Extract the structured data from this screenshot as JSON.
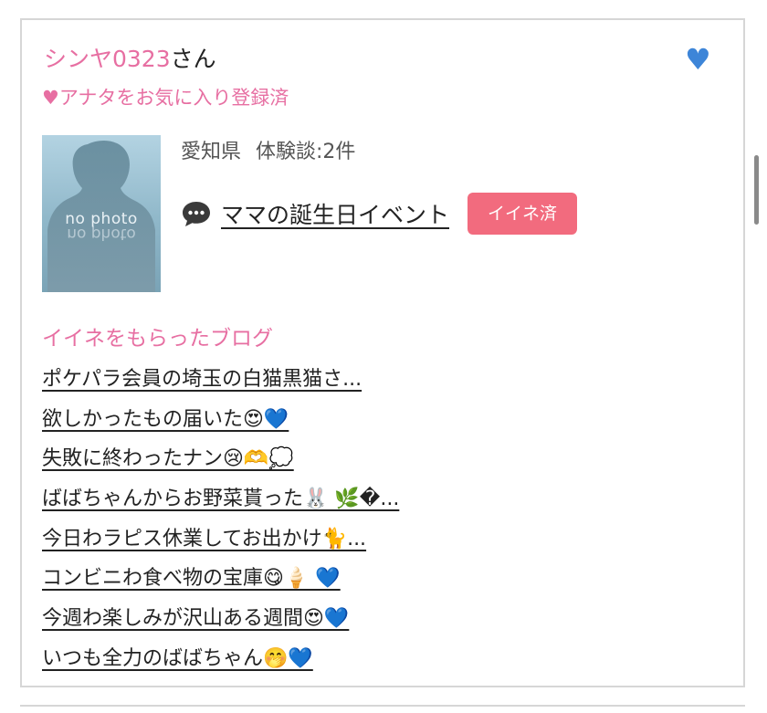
{
  "profile": {
    "user_name": "シンヤ0323",
    "name_suffix": "さん",
    "favorite_status": "♥アナタをお気に入り登録済",
    "favorite_icon": "heart-icon",
    "avatar_placeholder": "no photo",
    "location": "愛知県",
    "review_count": "体験談:2件",
    "event_title": "ママの誕生日イベント",
    "event_icon": "speech-bubble-icon",
    "like_badge": "イイネ済"
  },
  "liked_blogs": {
    "heading": "イイネをもらったブログ",
    "items": [
      {
        "title": "ポケパラ会員の埼玉の白猫黒猫さ..."
      },
      {
        "title": "欲しかったもの届いた😍💙"
      },
      {
        "title": "失敗に終わったナン😢🫶💭"
      },
      {
        "title": "ばばちゃんからお野菜貰った🐰 🌿�..."
      },
      {
        "title": "今日わラピス休業してお出かけ🐈..."
      },
      {
        "title": "コンビニわ食べ物の宝庫😋🍦 💙"
      },
      {
        "title": "今週わ楽しみが沢山ある週間😍💙"
      },
      {
        "title": "いつも全力のばばちゃん🤭💙"
      }
    ]
  },
  "colors": {
    "accent_pink": "#e76fa2",
    "like_badge": "#f26b7e",
    "heart_blue": "#3d85d8",
    "border": "#d6d6d6"
  }
}
